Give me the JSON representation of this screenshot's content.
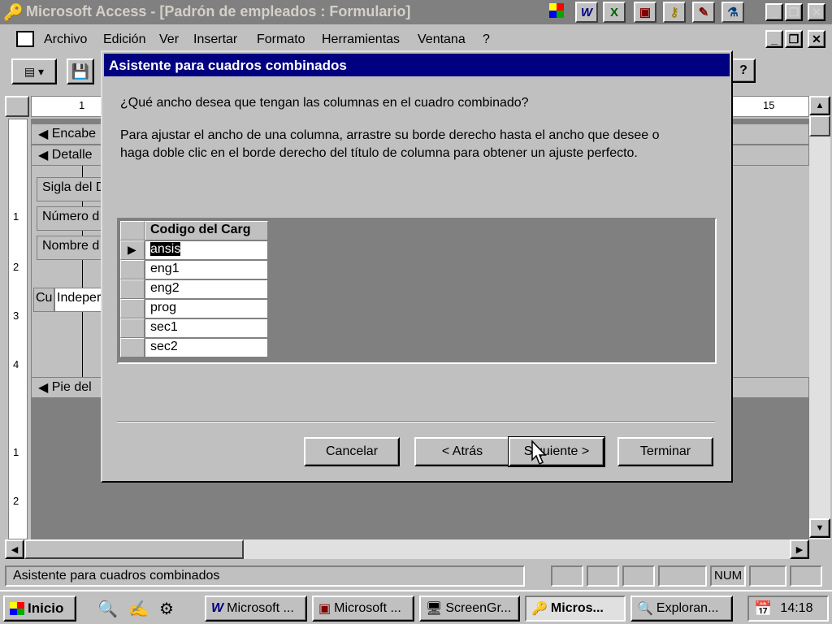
{
  "app": {
    "title": "Microsoft Access - [Padrón de empleados : Formulario]",
    "window_buttons": [
      "_",
      "🗗",
      "✕"
    ],
    "office_icons": [
      "W",
      "X",
      "▣",
      "🔑",
      "✎",
      "⚗"
    ]
  },
  "menu": {
    "items": [
      "Archivo",
      "Edición",
      "Ver",
      "Insertar",
      "Formato",
      "Herramientas",
      "Ventana",
      "?"
    ]
  },
  "toolbar": {
    "help_label": "?"
  },
  "ruler": {
    "top_marks": [
      "1",
      "15"
    ],
    "side_marks": [
      "1",
      "2",
      "3",
      "4",
      "1",
      "2"
    ]
  },
  "form_design": {
    "header_section": "Encabe",
    "detail_section": "Detalle",
    "footer_section": "Pie del",
    "fields": [
      "Sigla del D",
      "Número d",
      "Nombre d",
      "Cu",
      "Indeper"
    ]
  },
  "dialog": {
    "title": "Asistente para cuadros combinados",
    "question": "¿Qué ancho desea que tengan las columnas en el cuadro combinado?",
    "instructions_line1": "Para ajustar el ancho de una columna, arrastre su borde derecho hasta el ancho que desee o",
    "instructions_line2": "haga doble clic en el borde derecho del título de columna para obtener un ajuste perfecto.",
    "column_header": "Codigo del Carg",
    "rows": [
      "ansis",
      "eng1",
      "eng2",
      "prog",
      "sec1",
      "sec2"
    ],
    "buttons": {
      "cancel": "Cancelar",
      "back": "< Atrás",
      "next": "Siguiente >",
      "finish": "Terminar"
    }
  },
  "status": {
    "text": "Asistente para cuadros combinados",
    "num": "NUM"
  },
  "taskbar": {
    "start": "Inicio",
    "tasks": [
      "Microsoft ...",
      "Microsoft ...",
      "ScreenGr...",
      "Micros...",
      "Exploran..."
    ],
    "clock": "14:18"
  }
}
